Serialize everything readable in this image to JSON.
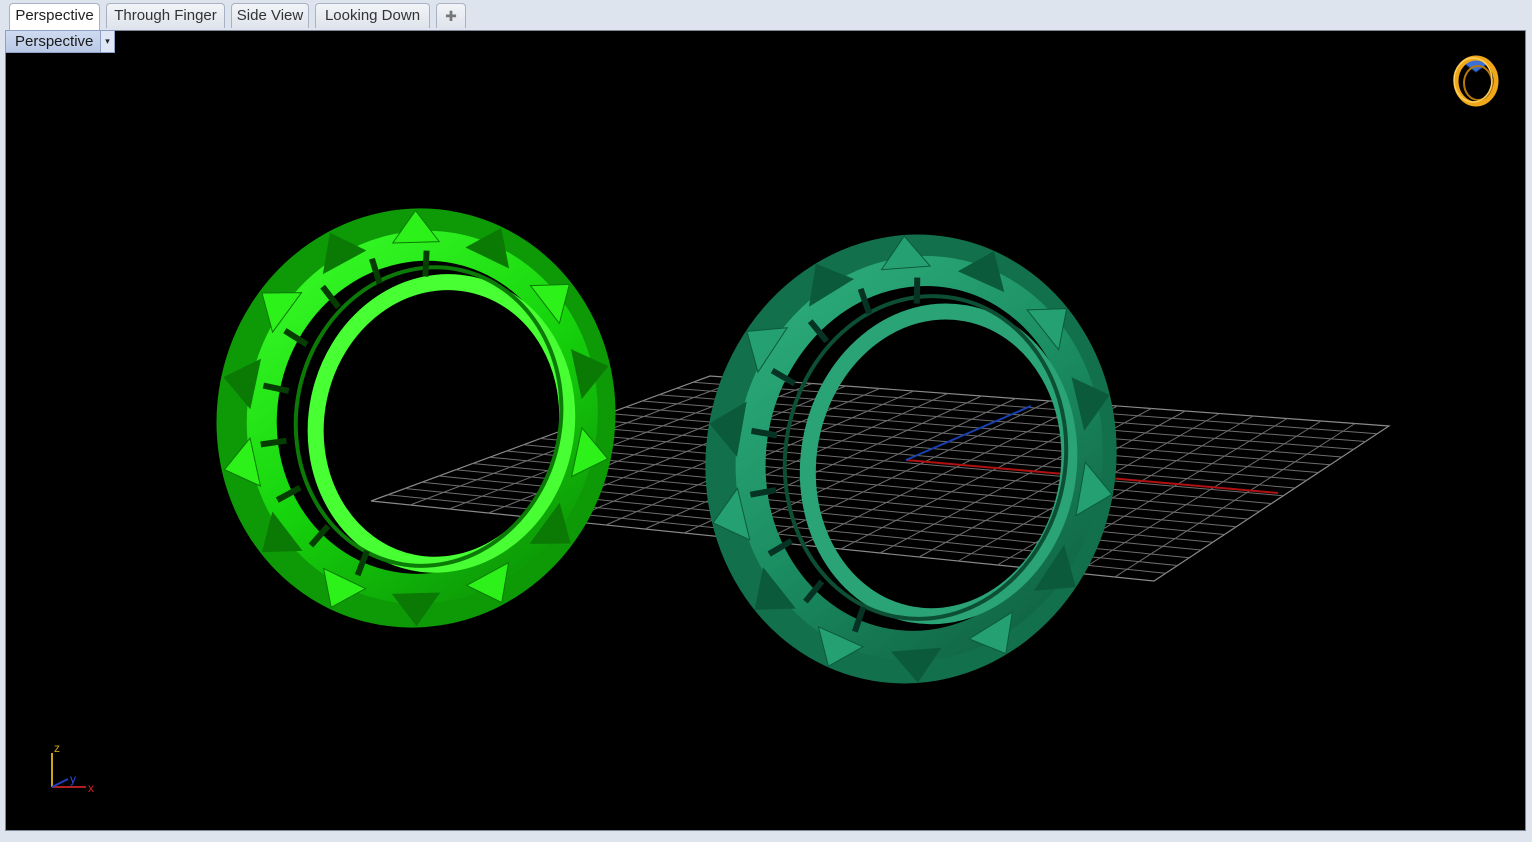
{
  "tabs": [
    {
      "label": "Perspective",
      "active": true
    },
    {
      "label": "Through Finger",
      "active": false
    },
    {
      "label": "Side View",
      "active": false
    },
    {
      "label": "Looking Down",
      "active": false
    }
  ],
  "add_tab_icon": "plus-icon",
  "viewport": {
    "title": "Perspective",
    "menu_arrow": "▾",
    "background": "#000000"
  },
  "models": [
    {
      "name": "ring-bright-green",
      "color": "#22dd11"
    },
    {
      "name": "ring-teal-green",
      "color": "#1a8f63"
    }
  ],
  "construction_grid": {
    "color": "#8a8a8a",
    "x_axis_color": "#b01010",
    "y_axis_color": "#1840b0"
  },
  "axes_widget": {
    "z": "z",
    "y": "y",
    "x": "x"
  },
  "logo": {
    "icon": "ring-logo-icon",
    "color": "#f0a818",
    "gem_color": "#3a6fd8"
  }
}
